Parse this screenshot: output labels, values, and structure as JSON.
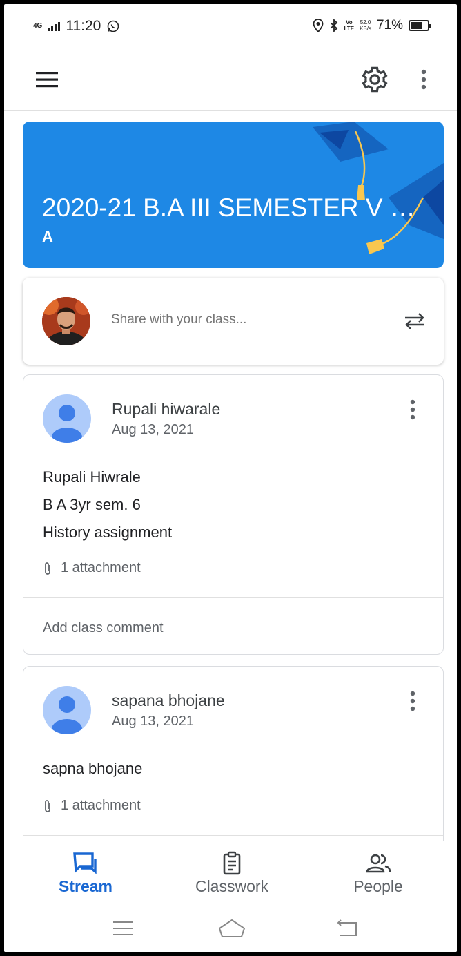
{
  "status_bar": {
    "network": "4G",
    "time": "11:20",
    "volte": "Vo",
    "lte": "LTE",
    "speed_value": "52.0",
    "speed_unit": "KB/s",
    "battery": "71%",
    "battery_level": 0.71
  },
  "banner": {
    "title": "2020-21 B.A III SEMESTER V Hi...",
    "section": "A",
    "color": "#1e88e5"
  },
  "share": {
    "placeholder": "Share with your class..."
  },
  "posts": [
    {
      "author": "Rupali hiwarale",
      "date": "Aug 13, 2021",
      "lines": [
        "Rupali Hiwrale",
        "B A 3yr sem. 6",
        "History assignment"
      ],
      "attachment": "1 attachment",
      "comment_placeholder": "Add class comment"
    },
    {
      "author": "sapana bhojane",
      "date": "Aug 13, 2021",
      "lines": [
        "sapna bhojane"
      ],
      "attachment": "1 attachment"
    }
  ],
  "bottom_nav": {
    "items": [
      {
        "label": "Stream",
        "icon": "stream-icon",
        "active": true
      },
      {
        "label": "Classwork",
        "icon": "classwork-icon",
        "active": false
      },
      {
        "label": "People",
        "icon": "people-icon",
        "active": false
      }
    ],
    "accent": "#1967d2"
  },
  "icons": {
    "menu": "hamburger-menu-icon",
    "settings": "gear-icon",
    "more": "more-vertical-icon",
    "repost": "repost-icon",
    "attachment": "paperclip-icon"
  }
}
